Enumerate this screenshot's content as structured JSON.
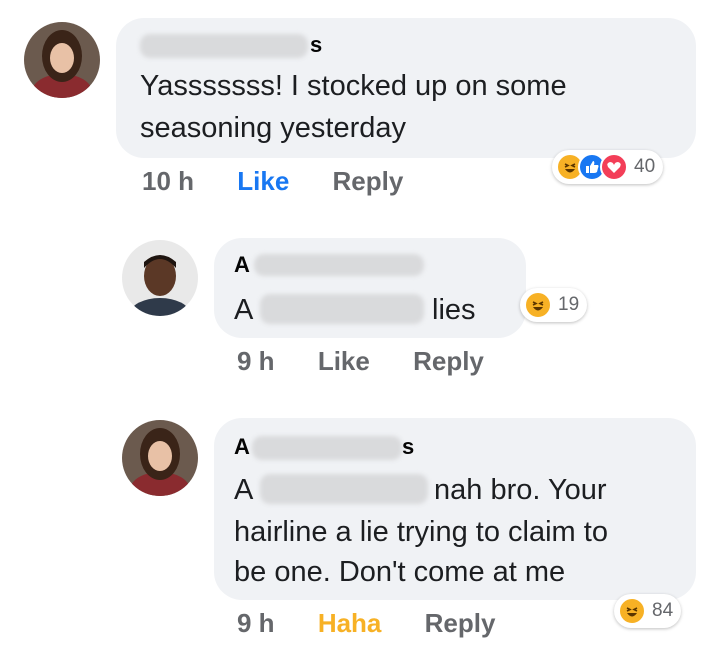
{
  "comments": [
    {
      "name_suffix": "s",
      "text_lines": [
        "Yasssssss! I stocked up on some",
        "seasoning yesterday"
      ],
      "time": "10 h",
      "action_1": "Like",
      "action_2": "Reply",
      "reaction_count": "40",
      "reaction_icons": [
        "haha-icon",
        "like-icon",
        "love-icon"
      ]
    },
    {
      "name_prefix": "A",
      "text_tail": "lies",
      "time": "9 h",
      "action_1": "Like",
      "action_2": "Reply",
      "reaction_count": "19",
      "reaction_icons": [
        "haha-icon"
      ]
    },
    {
      "name_prefix": "A",
      "name_suffix": "s",
      "mention_prefix": "A",
      "text_line_1_tail": "nah bro. Your",
      "text_lines": [
        "hairline a lie trying to claim to",
        "be one. Don't come at me"
      ],
      "time": "9 h",
      "action_1": "Haha",
      "action_2": "Reply",
      "reaction_count": "84",
      "reaction_icons": [
        "haha-icon"
      ]
    }
  ],
  "colors": {
    "like_blue": "#1877f2",
    "haha_yellow": "#f7b125",
    "love_red": "#f33e58",
    "bubble_bg": "#f0f2f5"
  }
}
